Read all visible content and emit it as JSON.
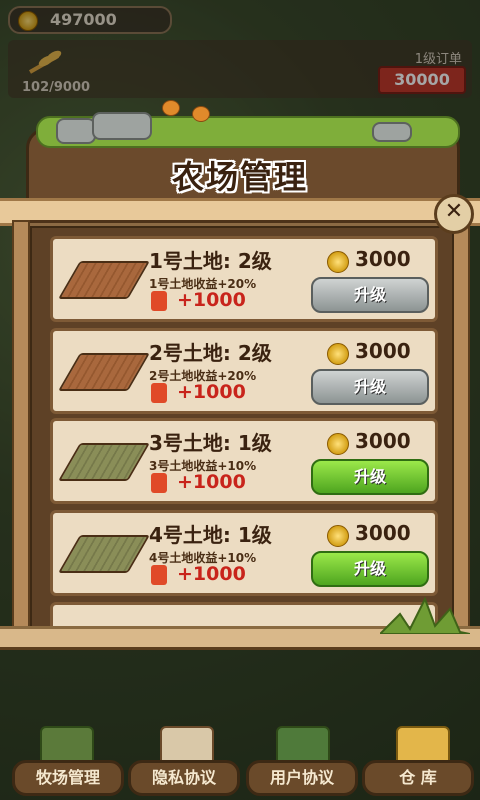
{
  "hud": {
    "coins": "497000",
    "progress": "102/9000",
    "order_label": "1级订单",
    "order_value": "30000"
  },
  "panel": {
    "title": "农场管理",
    "close_symbol": "✕"
  },
  "rows": [
    {
      "title": "1号土地: 2级",
      "sub": "1号土地收益+20%",
      "reward": "+1000",
      "cost": "3000",
      "button": "升级",
      "style": "gray",
      "plot": "brown"
    },
    {
      "title": "2号土地: 2级",
      "sub": "2号土地收益+20%",
      "reward": "+1000",
      "cost": "3000",
      "button": "升级",
      "style": "gray",
      "plot": "brown"
    },
    {
      "title": "3号土地: 1级",
      "sub": "3号土地收益+10%",
      "reward": "+1000",
      "cost": "3000",
      "button": "升级",
      "style": "green",
      "plot": "green"
    },
    {
      "title": "4号土地: 1级",
      "sub": "4号土地收益+10%",
      "reward": "+1000",
      "cost": "3000",
      "button": "升级",
      "style": "green",
      "plot": "green"
    }
  ],
  "nav": [
    {
      "label": "牧场管理"
    },
    {
      "label": "隐私协议"
    },
    {
      "label": "用户协议"
    },
    {
      "label": "仓  库"
    }
  ],
  "colors": {
    "upgrade_gray": "#8d9493",
    "upgrade_green": "#4ea51f",
    "reward_red": "#c8241b",
    "order_red": "#c0392b"
  }
}
